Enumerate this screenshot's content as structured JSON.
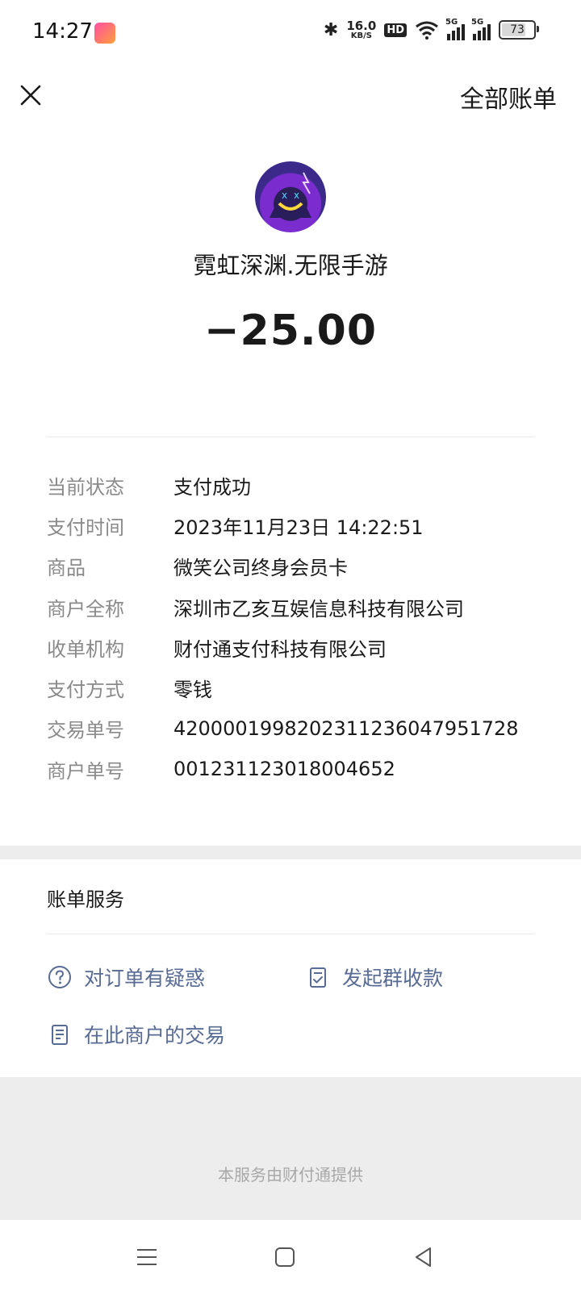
{
  "status_bar": {
    "time": "14:27",
    "net_speed_value": "16.0",
    "net_speed_unit": "KB/S",
    "hd_label": "HD",
    "signal1_label": "5G",
    "signal2_label": "5G",
    "battery_level": "73",
    "icons": [
      "bluetooth-icon",
      "wifi-icon",
      "signal-icon",
      "battery-icon"
    ]
  },
  "nav": {
    "close_icon": "close-icon",
    "all_bills_label": "全部账单"
  },
  "merchant": {
    "name": "霓虹深渊.无限手游",
    "amount": "−25.00"
  },
  "details": [
    {
      "label": "当前状态",
      "value": "支付成功"
    },
    {
      "label": "支付时间",
      "value": "2023年11月23日 14:22:51"
    },
    {
      "label": "商品",
      "value": "微笑公司终身会员卡"
    },
    {
      "label": "商户全称",
      "value": "深圳市乙亥互娱信息科技有限公司"
    },
    {
      "label": "收单机构",
      "value": "财付通支付科技有限公司"
    },
    {
      "label": "支付方式",
      "value": "零钱"
    },
    {
      "label": "交易单号",
      "value": "4200001998202311236047951728"
    },
    {
      "label": "商户单号",
      "value": "001231123018004652"
    }
  ],
  "services": {
    "title": "账单服务",
    "question_label": "对订单有疑惑",
    "group_collect_label": "发起群收款",
    "merchant_tx_label": "在此商户的交易"
  },
  "footer": {
    "note": "本服务由财付通提供"
  },
  "colors": {
    "link": "#576b95",
    "label": "#8a8a8a",
    "background": "#ededed"
  }
}
